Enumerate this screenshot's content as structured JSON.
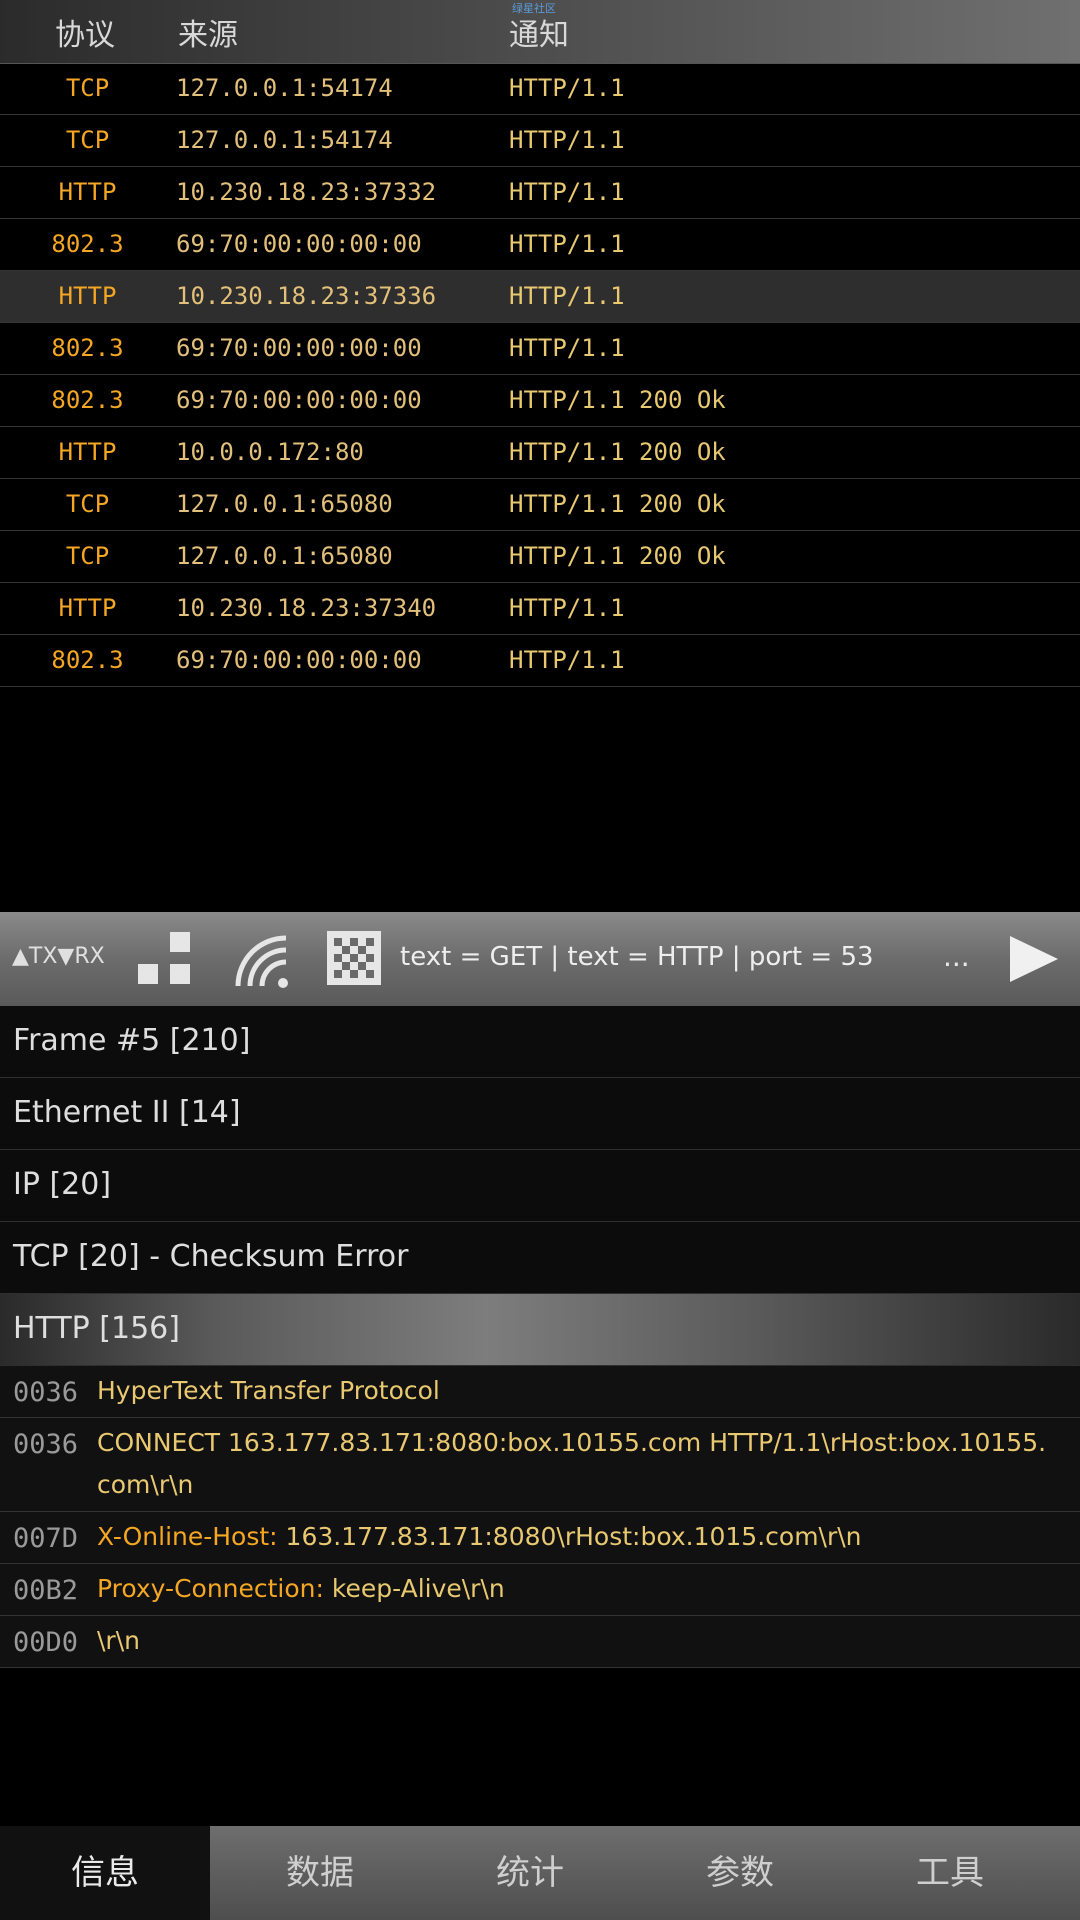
{
  "header": {
    "watermark": "绿星社区",
    "col_protocol": "协议",
    "col_source": "来源",
    "col_notify": "通知"
  },
  "packets": [
    {
      "protocol": "TCP",
      "source": "127.0.0.1:54174",
      "notify": "HTTP/1.1"
    },
    {
      "protocol": "TCP",
      "source": "127.0.0.1:54174",
      "notify": "HTTP/1.1"
    },
    {
      "protocol": "HTTP",
      "source": "10.230.18.23:37332",
      "notify": "HTTP/1.1"
    },
    {
      "protocol": "802.3",
      "source": "69:70:00:00:00:00",
      "notify": "HTTP/1.1"
    },
    {
      "protocol": "HTTP",
      "source": "10.230.18.23:37336",
      "notify": "HTTP/1.1"
    },
    {
      "protocol": "802.3",
      "source": "69:70:00:00:00:00",
      "notify": "HTTP/1.1"
    },
    {
      "protocol": "802.3",
      "source": "69:70:00:00:00:00",
      "notify": "HTTP/1.1 200 Ok"
    },
    {
      "protocol": "HTTP",
      "source": "10.0.0.172:80",
      "notify": "HTTP/1.1 200 Ok"
    },
    {
      "protocol": "TCP",
      "source": "127.0.0.1:65080",
      "notify": "HTTP/1.1 200 Ok"
    },
    {
      "protocol": "TCP",
      "source": "127.0.0.1:65080",
      "notify": "HTTP/1.1 200 Ok"
    },
    {
      "protocol": "HTTP",
      "source": "10.230.18.23:37340",
      "notify": "HTTP/1.1"
    },
    {
      "protocol": "802.3",
      "source": "69:70:00:00:00:00",
      "notify": "HTTP/1.1"
    }
  ],
  "toolbar": {
    "txrx": "▲TX▼RX",
    "filter": "text = GET | text = HTTP | port = 53",
    "more": "...",
    "icons": [
      "layout-icon",
      "wifi-icon",
      "grid-icon",
      "play-icon"
    ]
  },
  "sections": [
    "Frame #5 [210]",
    "Ethernet II [14]",
    "IP [20]",
    "TCP [20] - Checksum Error",
    "HTTP [156]"
  ],
  "hex": [
    {
      "offset": "0036",
      "key": "",
      "text": "HyperText Transfer Protocol"
    },
    {
      "offset": "0036",
      "key": "",
      "text": "CONNECT 163.177.83.171:8080:box.10155.com HTTP/1.1\\rHost:box.10155.com\\r\\n"
    },
    {
      "offset": "007D",
      "key": "X-Online-Host:",
      "text": " 163.177.83.171:8080\\rHost:box.1015.com\\r\\n"
    },
    {
      "offset": "00B2",
      "key": "Proxy-Connection:",
      "text": " keep-Alive\\r\\n"
    },
    {
      "offset": "00D0",
      "key": "",
      "text": "\\r\\n"
    }
  ],
  "tabs": [
    "信息",
    "数据",
    "统计",
    "参数",
    "工具"
  ],
  "colors": {
    "accent": "#f5a623",
    "text_yellow": "#e8c870"
  }
}
